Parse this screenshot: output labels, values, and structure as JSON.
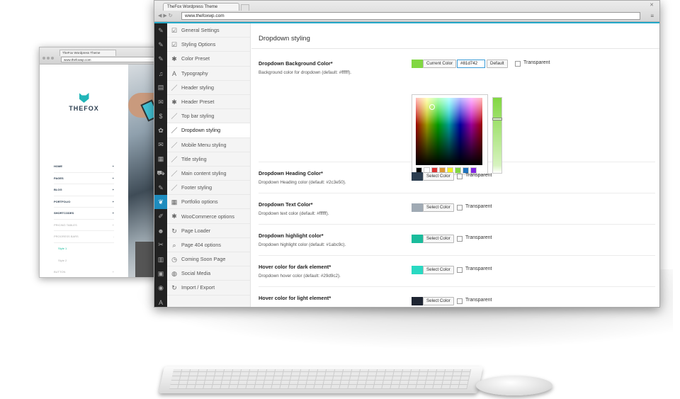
{
  "back_browser": {
    "tab_title": "TheFox Wordpress Theme",
    "url": "www.thefoxwp.com",
    "logo_text": "THEFOX",
    "menu": [
      {
        "label": "HOME",
        "style": "main",
        "arrow": "+"
      },
      {
        "label": "PAGES",
        "style": "main",
        "arrow": "+"
      },
      {
        "label": "BLOG",
        "style": "main",
        "arrow": "+"
      },
      {
        "label": "PORTFOLIO",
        "style": "main",
        "arrow": "+"
      },
      {
        "label": "SHORTCODES",
        "style": "main",
        "arrow": "+"
      },
      {
        "label": "PRICING TABLES",
        "style": "light",
        "arrow": "+"
      },
      {
        "label": "PROGRESS BARS",
        "style": "light",
        "arrow": "-"
      },
      {
        "label": "Style 1",
        "style": "sub",
        "arrow": ""
      },
      {
        "label": "Style 2",
        "style": "sub2",
        "arrow": ""
      },
      {
        "label": "BUTTON",
        "style": "light",
        "arrow": "+"
      },
      {
        "label": "TYPOGRAPHY",
        "style": "light",
        "arrow": "+"
      }
    ]
  },
  "front_browser": {
    "tab_title": "TheFox Wordpress Theme",
    "url": "www.thefoxwp.com",
    "window_close": "✕",
    "menu_icon": "≡",
    "nav_icons": "◀ ▶ ↻"
  },
  "wp_sidebar_icons": [
    "pin-icon",
    "pin-icon",
    "pin-icon",
    "media-icon",
    "pages-icon",
    "comments-icon",
    "dollar-icon",
    "palette-icon",
    "mail-icon",
    "layout-icon",
    "cart-icon",
    "pin-icon",
    "fox-icon",
    "brush-icon",
    "users-icon",
    "wrench-icon",
    "sliders-icon",
    "gallery-icon",
    "circle-icon",
    "font-icon",
    "revolution-icon"
  ],
  "wp_sidebar_glyphs": [
    "✎",
    "✎",
    "✎",
    "♫",
    "▤",
    "✉",
    "$",
    "✿",
    "✉",
    "▦",
    "⛟",
    "✎",
    "❦",
    "✐",
    "☻",
    "✂",
    "▥",
    "▣",
    "◉",
    "A",
    "◐"
  ],
  "options_menu": {
    "active": "Dropdown styling",
    "items": [
      {
        "label": "General Settings",
        "icon": "edit-icon",
        "glyph": "☑"
      },
      {
        "label": "Styling Options",
        "icon": "edit-icon",
        "glyph": "☑"
      },
      {
        "label": "Color Preset",
        "icon": "gear-icon",
        "glyph": "✱"
      },
      {
        "label": "Typography",
        "icon": "font-icon",
        "glyph": "A"
      },
      {
        "label": "Header styling",
        "icon": "pencil-icon",
        "glyph": "／"
      },
      {
        "label": "Header Preset",
        "icon": "gear-icon",
        "glyph": "✱"
      },
      {
        "label": "Top bar styling",
        "icon": "pencil-icon",
        "glyph": "／"
      },
      {
        "label": "Dropdown styling",
        "icon": "pencil-icon",
        "glyph": "／"
      },
      {
        "label": "Mobile Menu styling",
        "icon": "pencil-icon",
        "glyph": "／"
      },
      {
        "label": "Title styling",
        "icon": "pencil-icon",
        "glyph": "／"
      },
      {
        "label": "Main content styling",
        "icon": "pencil-icon",
        "glyph": "／"
      },
      {
        "label": "Footer styling",
        "icon": "pencil-icon",
        "glyph": "／"
      },
      {
        "label": "Portfolio options",
        "icon": "grid-icon",
        "glyph": "▦"
      },
      {
        "label": "WooCommerce options",
        "icon": "gear-icon",
        "glyph": "✱"
      },
      {
        "label": "Page Loader",
        "icon": "refresh-icon",
        "glyph": "↻"
      },
      {
        "label": "Page 404 options",
        "icon": "search-icon",
        "glyph": "⌕"
      },
      {
        "label": "Coming Soon Page",
        "icon": "clock-icon",
        "glyph": "◷"
      },
      {
        "label": "Social Media",
        "icon": "globe-icon",
        "glyph": "◍"
      },
      {
        "label": "Import / Export",
        "icon": "refresh-icon",
        "glyph": "↻"
      }
    ]
  },
  "content": {
    "title": "Dropdown styling",
    "bg_row": {
      "label": "Dropdown Background Color*",
      "desc": "Background color for dropdown (default: #ffffff).",
      "swatch_color": "#81d742",
      "current_button": "Current Color",
      "hex_value": "#81d742",
      "default_button": "Default",
      "transparent_label": "Transparent",
      "palette": [
        "#000000",
        "#ffffff",
        "#dd3333",
        "#dd9933",
        "#eeee22",
        "#81d742",
        "#1e73be",
        "#8224e3"
      ]
    },
    "rows": [
      {
        "label": "Dropdown Heading Color*",
        "desc": "Dropdown Heading color (default: #2c3e50).",
        "color": "#2c3e50",
        "button": "Select Color",
        "transparent_label": "Transparent"
      },
      {
        "label": "Dropdown Text Color*",
        "desc": "Dropdown text color (default: #ffffff).",
        "color": "#a0aab4",
        "button": "Select Color",
        "transparent_label": "Transparent"
      },
      {
        "label": "Dropdown highlight color*",
        "desc": "Dropdown highlight color (default: #1abc9c).",
        "color": "#1abc9c",
        "button": "Select Color",
        "transparent_label": "Transparent"
      },
      {
        "label": "Hover color for dark element*",
        "desc": "Dropdown hover color (default: #29d9c2).",
        "color": "#29d9c2",
        "button": "Select Color",
        "transparent_label": "Transparent"
      },
      {
        "label": "Hover color for light element*",
        "desc": "",
        "color": "#1f2633",
        "button": "Select Color",
        "transparent_label": "Transparent"
      }
    ]
  }
}
